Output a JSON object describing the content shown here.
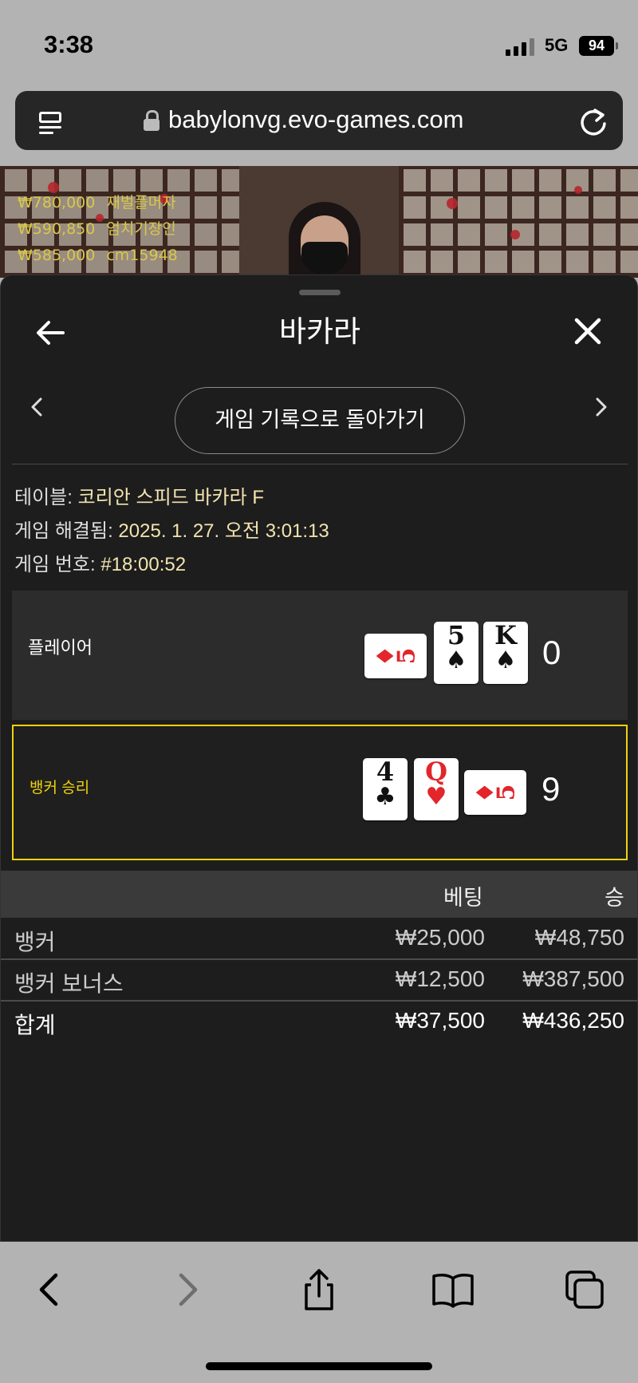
{
  "status_bar": {
    "time": "3:38",
    "network": "5G",
    "battery": "94"
  },
  "browser": {
    "url": "babylonvg.evo-games.com"
  },
  "video": {
    "leaderboard": [
      {
        "amount": "₩780,000",
        "name": "재벌플머자"
      },
      {
        "amount": "₩590,850",
        "name": "엄치기장인"
      },
      {
        "amount": "₩585,000",
        "name": "cm15948"
      }
    ]
  },
  "sheet": {
    "title": "바카라",
    "back_to_history_label": "게임 기록으로 돌아가기",
    "info": {
      "table_label": "테이블:",
      "table_value": "코리안 스피드 바카라 F",
      "resolved_label": "게임 해결됨:",
      "resolved_value": "2025. 1. 27. 오전 3:01:13",
      "number_label": "게임 번호:",
      "number_value": "#18:00:52"
    },
    "player": {
      "label": "플레이어",
      "score": "0",
      "cards": [
        {
          "rank": "5",
          "suit": "♦",
          "color": "#e2262b",
          "rotated": true
        },
        {
          "rank": "5",
          "suit": "♠",
          "color": "#111111",
          "rotated": false
        },
        {
          "rank": "K",
          "suit": "♠",
          "color": "#111111",
          "rotated": false
        }
      ]
    },
    "banker": {
      "label": "뱅커 승리",
      "label_color": "#f0d20a",
      "score": "9",
      "cards": [
        {
          "rank": "4",
          "suit": "♣",
          "color": "#111111",
          "rotated": false
        },
        {
          "rank": "Q",
          "suit": "♥",
          "color": "#e2262b",
          "rotated": false
        },
        {
          "rank": "5",
          "suit": "♦",
          "color": "#e2262b",
          "rotated": true
        }
      ]
    },
    "bets": {
      "headers": {
        "bet": "베팅",
        "win": "승"
      },
      "rows": [
        {
          "name": "뱅커",
          "bet": "₩25,000",
          "win": "₩48,750"
        },
        {
          "name": "뱅커 보너스",
          "bet": "₩12,500",
          "win": "₩387,500"
        }
      ],
      "total": {
        "name": "합계",
        "bet": "₩37,500",
        "win": "₩436,250"
      }
    }
  }
}
